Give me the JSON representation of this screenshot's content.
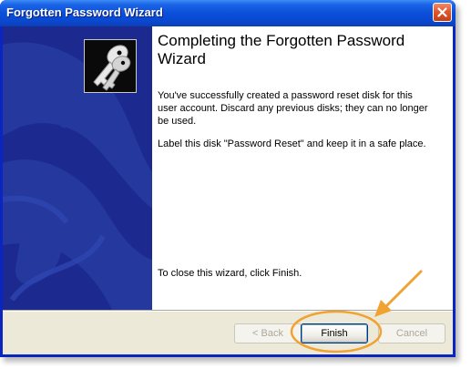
{
  "window": {
    "title": "Forgotten Password Wizard"
  },
  "wizard": {
    "heading": "Completing the Forgotten Password Wizard",
    "paragraph_1": "You've successfully created a password reset disk for this user account. Discard any previous disks; they can no longer be used.",
    "paragraph_2": "Label this disk \"Password Reset\" and keep it in a safe place.",
    "closing_text": "To close this wizard, click Finish."
  },
  "buttons": {
    "back": "< Back",
    "finish": "Finish",
    "cancel": "Cancel"
  },
  "icons": {
    "close": "close-icon",
    "wizard": "keys-icon",
    "annotation": "arrow-annotation"
  },
  "colors": {
    "titlebar": "#0b4fd9",
    "side_panel": "#1c2a8f",
    "annotation": "#f0a233",
    "button_bar": "#ece9d8"
  }
}
